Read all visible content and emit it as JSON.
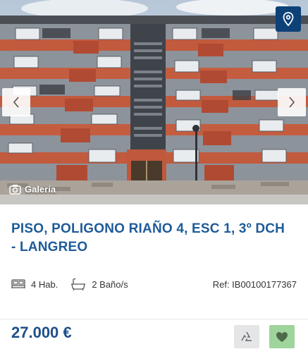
{
  "listing": {
    "gallery_label": "Galería",
    "title": "PISO, POLIGONO RIAÑO 4, ESC 1, 3º DCH - LANGREO",
    "rooms": "4 Hab.",
    "baths": "2 Baño/s",
    "reference": "Ref: IB00100177367",
    "price": "27.000 €"
  },
  "icons": {
    "map": "map-pin-icon",
    "prev": "chevron-left-icon",
    "next": "chevron-right-icon",
    "gallery": "camera-icon",
    "rooms": "bed-icon",
    "baths": "bathtub-icon",
    "share": "recycle-icon",
    "favorite": "heart-icon"
  },
  "colors": {
    "title": "#1e5b9a",
    "price": "#1e4f8a",
    "map_button": "#0d4178",
    "favorite_button": "#9fd49c",
    "share_button": "#e4e6e8"
  }
}
